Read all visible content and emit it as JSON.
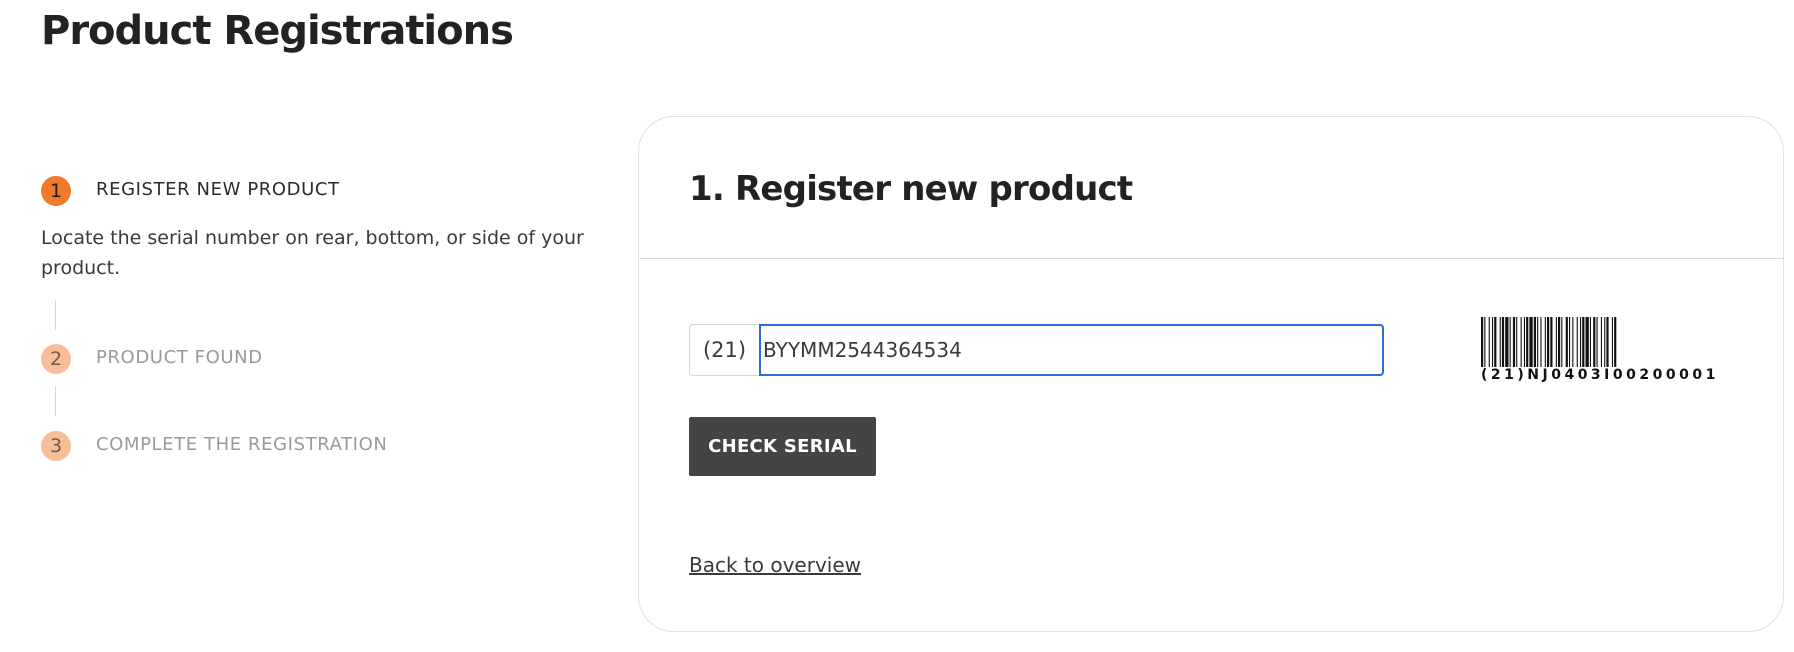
{
  "page": {
    "title": "Product Registrations"
  },
  "stepper": {
    "steps": [
      {
        "number": "1",
        "label": "REGISTER NEW PRODUCT",
        "state": "active"
      },
      {
        "number": "2",
        "label": "PRODUCT FOUND",
        "state": "inactive"
      },
      {
        "number": "3",
        "label": "COMPLETE THE REGISTRATION",
        "state": "inactive"
      }
    ],
    "description": "Locate the serial number on rear, bottom, or side of your product."
  },
  "card": {
    "title": "1. Register new product",
    "serial": {
      "prefix": "(21)",
      "value": "BYYMM2544364534"
    },
    "check_button_label": "CHECK SERIAL",
    "back_link_label": "Back to overview",
    "barcode": {
      "icon": "barcode-icon",
      "caption": "(21)NJ0403I00200001"
    }
  },
  "colors": {
    "accent": "#f27b2b",
    "accent_light": "#f8be99",
    "button_bg": "#444444",
    "input_focus": "#2b6fd6"
  }
}
